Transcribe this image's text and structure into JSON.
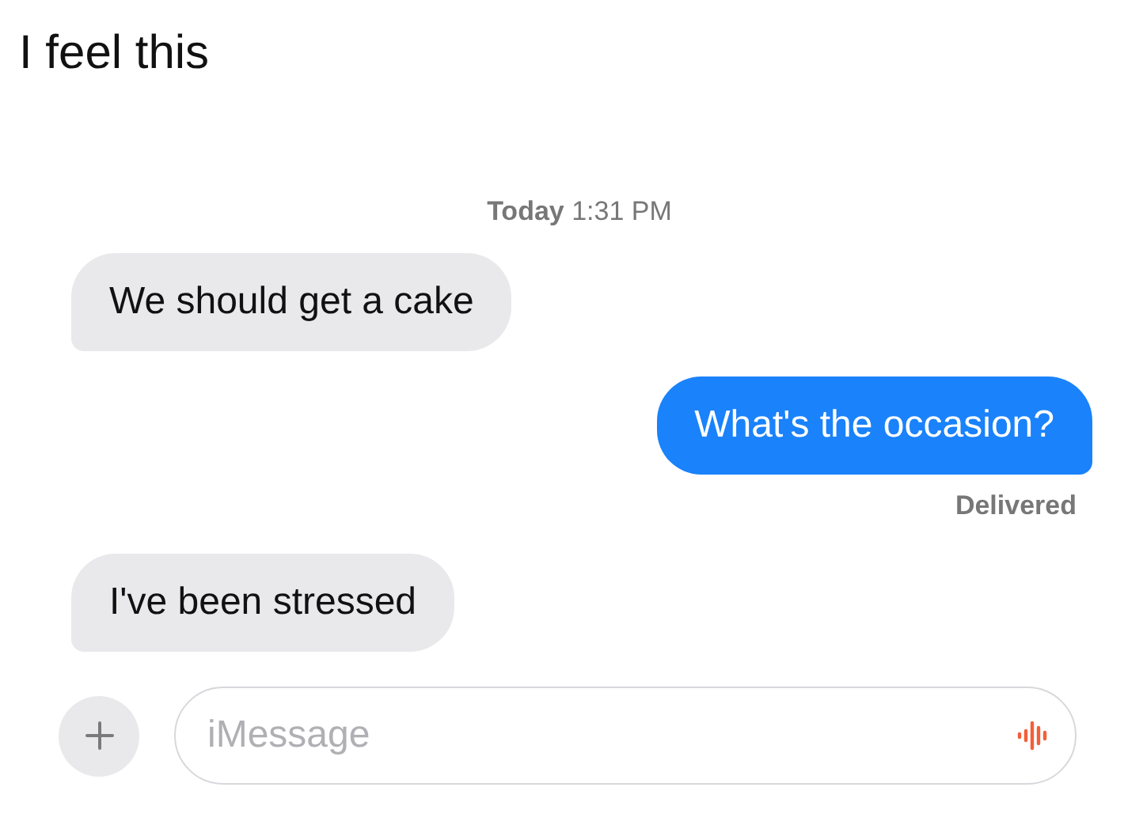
{
  "caption": "I feel this",
  "timestamp": "**Today** 1:31 PM",
  "messages": [
    {
      "kind": "received",
      "text": "We should get a cake"
    },
    {
      "kind": "sent",
      "text": "What's the occasion?",
      "status": "Delivered"
    },
    {
      "kind": "received",
      "text": "I've been stressed"
    }
  ],
  "composer": {
    "placeholder": "iMessage"
  }
}
